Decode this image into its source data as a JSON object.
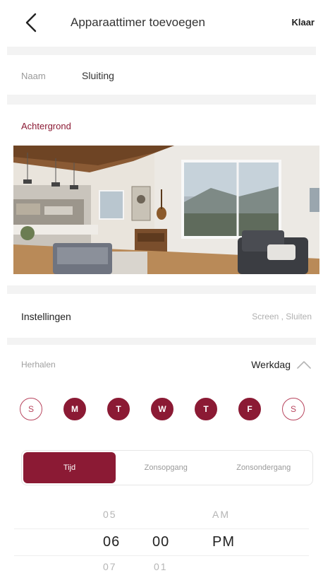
{
  "header": {
    "title": "Apparaattimer toevoegen",
    "done_label": "Klaar",
    "back_icon": "chevron-left-icon"
  },
  "name": {
    "label": "Naam",
    "value": "Sluiting"
  },
  "background": {
    "label": "Achtergrond",
    "image": "living-room-photo"
  },
  "settings": {
    "label": "Instellingen",
    "value": "Screen , Sluiten"
  },
  "repeat": {
    "label": "Herhalen",
    "value": "Werkdag",
    "toggle_icon": "chevron-up-icon"
  },
  "days": [
    {
      "label": "S",
      "selected": false
    },
    {
      "label": "M",
      "selected": true
    },
    {
      "label": "T",
      "selected": true
    },
    {
      "label": "W",
      "selected": true
    },
    {
      "label": "T",
      "selected": true
    },
    {
      "label": "F",
      "selected": true
    },
    {
      "label": "S",
      "selected": false
    }
  ],
  "trigger_tabs": [
    {
      "label": "Tijd",
      "active": true
    },
    {
      "label": "Zonsopgang",
      "active": false
    },
    {
      "label": "Zonsondergang",
      "active": false
    }
  ],
  "time_picker": {
    "hours": {
      "prev": "05",
      "selected": "06",
      "next": "07"
    },
    "minutes": {
      "prev": "",
      "selected": "00",
      "next": "01"
    },
    "period": {
      "prev": "AM",
      "selected": "PM",
      "next": ""
    }
  },
  "colors": {
    "accent": "#8b1a34",
    "accent_light": "#b8455e",
    "divider": "#f3f3f3"
  }
}
